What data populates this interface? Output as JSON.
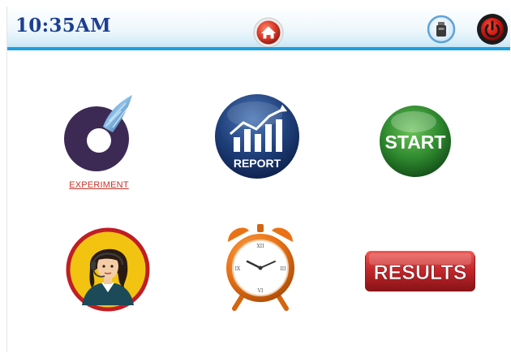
{
  "status_bar": {
    "time": "10:35AM",
    "icons": [
      "home-icon",
      "usb-drive-icon",
      "power-icon"
    ]
  },
  "tiles": {
    "experiment": {
      "label": "EXPERIMENT",
      "icon": "experiment-logo-icon"
    },
    "report": {
      "label": "REPORT",
      "icon": "report-chart-icon"
    },
    "start": {
      "label": "START",
      "icon": "start-button-icon"
    },
    "support": {
      "icon": "support-agent-icon"
    },
    "clock": {
      "icon": "alarm-clock-icon"
    },
    "results": {
      "label": "RESULTS",
      "icon": "results-button-icon"
    }
  },
  "colors": {
    "header_accent": "#1ea0de",
    "time_text": "#1c3f91",
    "home_red": "#d8342a",
    "start_green": "#2f8a2f",
    "results_red": "#c3272b",
    "report_navy": "#1f3f7a",
    "experiment_purple": "#3c2a55"
  }
}
